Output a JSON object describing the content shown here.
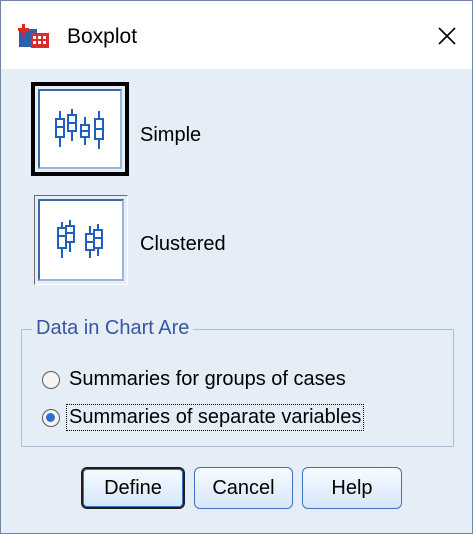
{
  "window": {
    "title": "Boxplot"
  },
  "chart_types": [
    {
      "label": "Simple",
      "selected": true
    },
    {
      "label": "Clustered",
      "selected": false
    }
  ],
  "data_group": {
    "legend": "Data in Chart Are",
    "options": [
      {
        "label": "Summaries for groups of cases",
        "checked": false
      },
      {
        "label": "Summaries of separate variables",
        "checked": true
      }
    ]
  },
  "buttons": {
    "define": "Define",
    "cancel": "Cancel",
    "help": "Help"
  },
  "colors": {
    "background": "#e5edf7",
    "accent": "#2f6fd4",
    "border": "#3b74c2"
  }
}
